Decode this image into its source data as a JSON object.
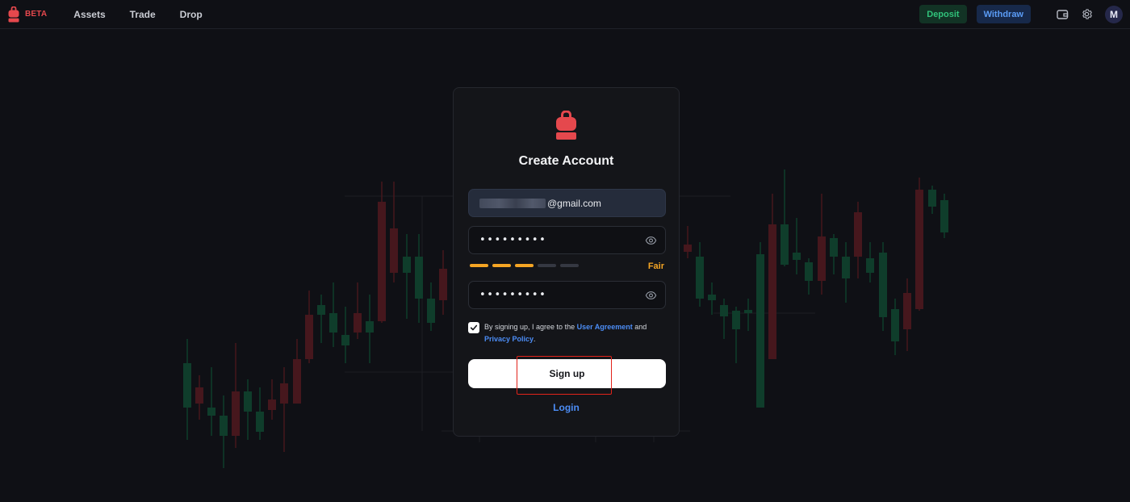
{
  "nav": {
    "beta_label": "BETA",
    "links": [
      "Assets",
      "Trade",
      "Drop"
    ],
    "deposit_label": "Deposit",
    "withdraw_label": "Withdraw",
    "avatar_initial": "M"
  },
  "card": {
    "title": "Create Account",
    "email_suffix": "@gmail.com",
    "password_mask": "•••••••••",
    "confirm_mask": "•••••••••",
    "strength": {
      "label": "Fair",
      "level": 3,
      "max": 5
    },
    "terms": {
      "checked": true,
      "prefix": "By signing up, I agree to the ",
      "user_agreement": "User Agreement",
      "and": " and ",
      "privacy_policy": "Privacy Policy",
      "suffix": "."
    },
    "signup_label": "Sign up",
    "login_label": "Login"
  },
  "colors": {
    "brand_red": "#e5484d",
    "deposit_green": "#30c27a",
    "withdraw_blue": "#5b9cf6",
    "strength_amber": "#f5a524",
    "link_blue": "#4c8df6",
    "highlight_red": "#e2231a"
  },
  "icons": {
    "logo": "backpack-lock-icon",
    "wallet": "wallet-icon",
    "settings": "gear-icon",
    "reveal": "eye-icon",
    "check": "check-icon"
  }
}
